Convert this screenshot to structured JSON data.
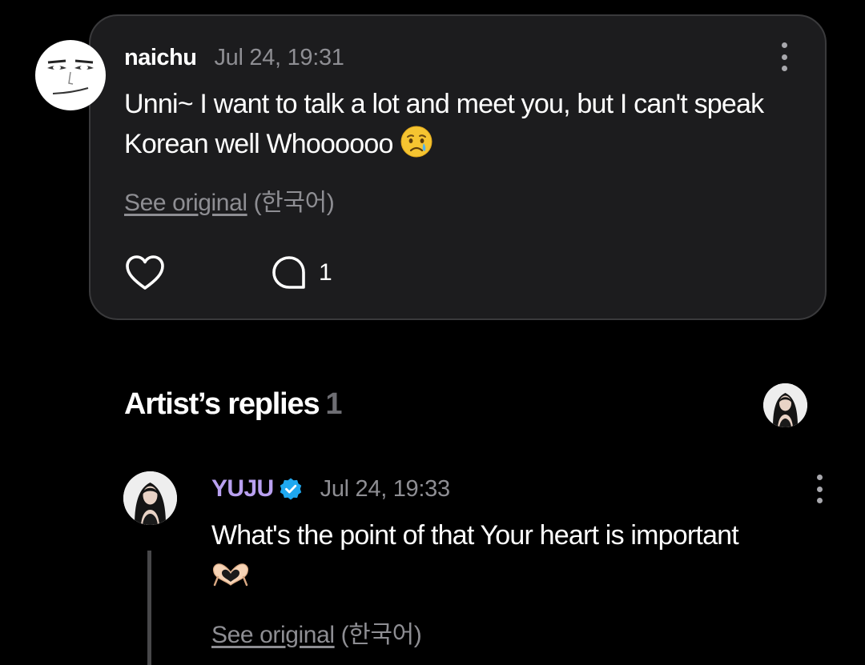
{
  "comment": {
    "author": "naichu",
    "time": "Jul 24, 19:31",
    "text": "Unni~ I want to talk a lot and meet you, but I can't speak Korean well Whoooooo",
    "emoji": "crying-face-emoji",
    "see_original_link": "See original",
    "see_original_lang": "(한국어)",
    "reply_count": "1",
    "icons": {
      "more": "more-vertical-icon",
      "like": "heart-outline-icon",
      "reply": "speech-bubble-icon"
    }
  },
  "artist_replies": {
    "title": "Artist’s replies",
    "count": "1",
    "reply": {
      "author": "YUJU",
      "verified": true,
      "time": "Jul 24, 19:33",
      "text": "What's the point of that Your heart is important",
      "emoji": "heart-hands-emoji",
      "see_original_link": "See original",
      "see_original_lang": "(한국어)"
    }
  },
  "colors": {
    "background": "#000000",
    "card": "#1c1c1e",
    "card_border": "#3a3a3c",
    "muted_text": "#8e8e93",
    "artist_name": "#b9a0f0",
    "verified_badge": "#1fa8f0"
  }
}
